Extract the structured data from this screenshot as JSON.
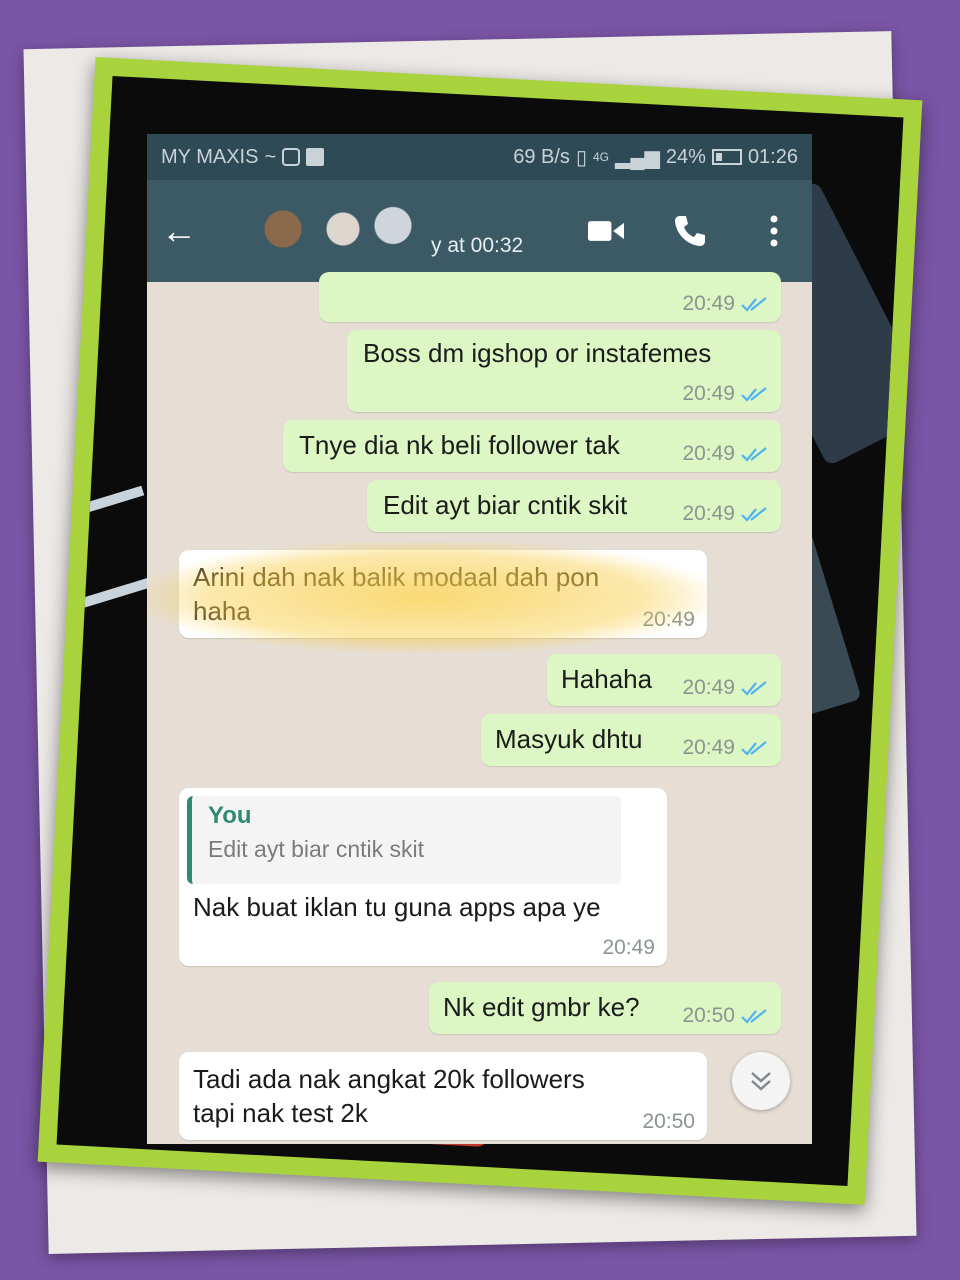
{
  "status_bar": {
    "carrier": "MY MAXIS",
    "net_speed": "69 B/s",
    "network": "4G",
    "battery": "24%",
    "time": "01:26"
  },
  "header": {
    "last_seen": "y at 00:32"
  },
  "messages": [
    {
      "dir": "out",
      "text": "",
      "time": "20:49"
    },
    {
      "dir": "out",
      "text": "Boss dm igshop or instafemes",
      "time": "20:49"
    },
    {
      "dir": "out",
      "text": "Tnye dia nk beli follower tak",
      "time": "20:49"
    },
    {
      "dir": "out",
      "text": "Edit ayt biar cntik skit",
      "time": "20:49"
    },
    {
      "dir": "in",
      "line1": "Arini dah nak balik modaal dah pon",
      "line2": "haha",
      "time": "20:49"
    },
    {
      "dir": "out",
      "text": "Hahaha",
      "time": "20:49"
    },
    {
      "dir": "out",
      "text": "Masyuk dhtu",
      "time": "20:49"
    },
    {
      "dir": "in",
      "quote_name": "You",
      "quote_text": "Edit ayt biar cntik skit",
      "text": "Nak buat iklan tu guna apps apa ye",
      "time": "20:49"
    },
    {
      "dir": "out",
      "text": "Nk edit gmbr ke?",
      "time": "20:50"
    },
    {
      "dir": "in",
      "line1": "Tadi ada nak angkat 20k followers",
      "line2": "tapi nak test 2k",
      "time": "20:50"
    }
  ],
  "colors": {
    "outgoing": "#dcf6c4",
    "incoming": "#ffffff",
    "appbar": "#3c5a66",
    "tick_read": "#4fb3f2",
    "frame": "#a8d33c"
  }
}
